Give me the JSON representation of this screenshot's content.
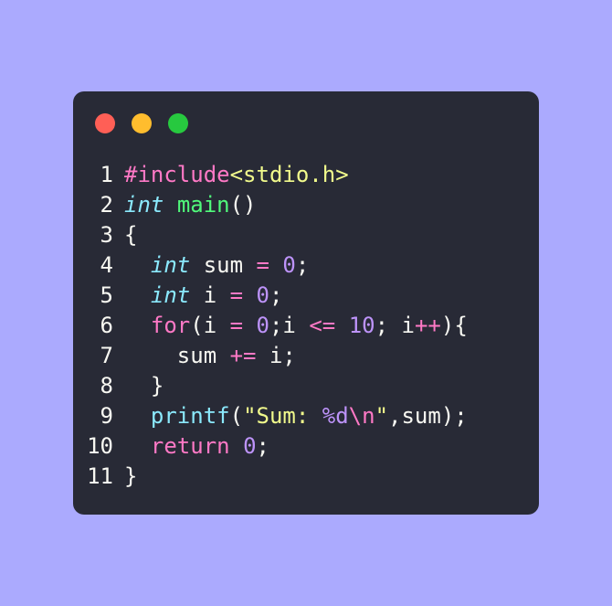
{
  "window": {
    "controls": [
      {
        "name": "close",
        "color": "#ff5f56"
      },
      {
        "name": "minimize",
        "color": "#ffbd2e"
      },
      {
        "name": "maximize",
        "color": "#27c93f"
      }
    ]
  },
  "code": {
    "lines": [
      {
        "n": "1",
        "tokens": [
          {
            "t": "#include",
            "c": "pink"
          },
          {
            "t": "<stdio.h>",
            "c": "yellow"
          }
        ]
      },
      {
        "n": "2",
        "tokens": [
          {
            "t": "int",
            "c": "kw-ital"
          },
          {
            "t": " ",
            "c": "plain"
          },
          {
            "t": "main",
            "c": "green"
          },
          {
            "t": "()",
            "c": "plain"
          }
        ]
      },
      {
        "n": "3",
        "tokens": [
          {
            "t": "{",
            "c": "plain"
          }
        ]
      },
      {
        "n": "4",
        "tokens": [
          {
            "t": "  ",
            "c": "plain"
          },
          {
            "t": "int",
            "c": "kw-ital"
          },
          {
            "t": " sum ",
            "c": "plain"
          },
          {
            "t": "=",
            "c": "pink"
          },
          {
            "t": " ",
            "c": "plain"
          },
          {
            "t": "0",
            "c": "purple"
          },
          {
            "t": ";",
            "c": "plain"
          }
        ]
      },
      {
        "n": "5",
        "tokens": [
          {
            "t": "  ",
            "c": "plain"
          },
          {
            "t": "int",
            "c": "kw-ital"
          },
          {
            "t": " i ",
            "c": "plain"
          },
          {
            "t": "=",
            "c": "pink"
          },
          {
            "t": " ",
            "c": "plain"
          },
          {
            "t": "0",
            "c": "purple"
          },
          {
            "t": ";",
            "c": "plain"
          }
        ]
      },
      {
        "n": "6",
        "tokens": [
          {
            "t": "  ",
            "c": "plain"
          },
          {
            "t": "for",
            "c": "pink"
          },
          {
            "t": "(i ",
            "c": "plain"
          },
          {
            "t": "=",
            "c": "pink"
          },
          {
            "t": " ",
            "c": "plain"
          },
          {
            "t": "0",
            "c": "purple"
          },
          {
            "t": ";i ",
            "c": "plain"
          },
          {
            "t": "<=",
            "c": "pink"
          },
          {
            "t": " ",
            "c": "plain"
          },
          {
            "t": "10",
            "c": "purple"
          },
          {
            "t": "; i",
            "c": "plain"
          },
          {
            "t": "++",
            "c": "pink"
          },
          {
            "t": "){",
            "c": "plain"
          }
        ]
      },
      {
        "n": "7",
        "tokens": [
          {
            "t": "    sum ",
            "c": "plain"
          },
          {
            "t": "+=",
            "c": "pink"
          },
          {
            "t": " i;",
            "c": "plain"
          }
        ]
      },
      {
        "n": "8",
        "tokens": [
          {
            "t": "  }",
            "c": "plain"
          }
        ]
      },
      {
        "n": "9",
        "tokens": [
          {
            "t": "  ",
            "c": "plain"
          },
          {
            "t": "printf",
            "c": "cyan"
          },
          {
            "t": "(",
            "c": "plain"
          },
          {
            "t": "\"Sum: ",
            "c": "yellow"
          },
          {
            "t": "%d",
            "c": "purple"
          },
          {
            "t": "\\n",
            "c": "pink"
          },
          {
            "t": "\"",
            "c": "yellow"
          },
          {
            "t": ",sum);",
            "c": "plain"
          }
        ]
      },
      {
        "n": "10",
        "tokens": [
          {
            "t": "  ",
            "c": "plain"
          },
          {
            "t": "return",
            "c": "pink"
          },
          {
            "t": " ",
            "c": "plain"
          },
          {
            "t": "0",
            "c": "purple"
          },
          {
            "t": ";",
            "c": "plain"
          }
        ]
      },
      {
        "n": "11",
        "tokens": [
          {
            "t": "}",
            "c": "plain"
          }
        ]
      }
    ]
  }
}
